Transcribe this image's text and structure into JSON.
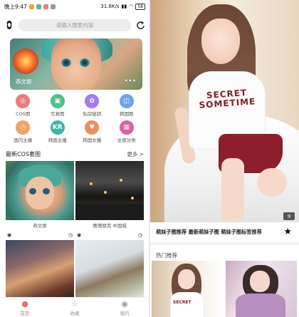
{
  "status": {
    "time": "晚上9:47",
    "speed": "31.6K/s",
    "battery": "58"
  },
  "search": {
    "placeholder": "请输入搜索内容"
  },
  "banner": {
    "title": "燕文姬",
    "dots": "•••"
  },
  "categories": [
    {
      "label": "COS图",
      "color": "#f07a7a",
      "icon": "cos-icon",
      "glyph": "◎"
    },
    {
      "label": "写真图",
      "color": "#4cc38a",
      "icon": "photo-icon",
      "glyph": "▣"
    },
    {
      "label": "私房秘钥",
      "color": "#a27cf0",
      "icon": "key-icon",
      "glyph": "✿"
    },
    {
      "label": "韩国图",
      "color": "#6aa4f3",
      "icon": "bag-icon",
      "glyph": "◫"
    },
    {
      "label": "国内主播",
      "color": "#f6a15a",
      "icon": "clock-icon",
      "glyph": "◷"
    },
    {
      "label": "韩国主播",
      "color": "#38b9a8",
      "icon": "kr-icon",
      "glyph": "KR"
    },
    {
      "label": "韩国女播",
      "color": "#f08d5c",
      "icon": "heart-icon",
      "glyph": "♥"
    },
    {
      "label": "全部分类",
      "color": "#e35da2",
      "icon": "grid-icon",
      "glyph": "▦"
    }
  ],
  "section": {
    "title": "最新COS套图",
    "more": "更多 >"
  },
  "tiles": [
    {
      "caption": "燕文姬"
    },
    {
      "caption": "赛博朋克 中国城"
    }
  ],
  "tabs": [
    {
      "label": "首页",
      "icon": "home-icon",
      "glyph": "●"
    },
    {
      "label": "收藏",
      "icon": "star-outline-icon",
      "glyph": "☆"
    },
    {
      "label": "我的",
      "icon": "user-icon",
      "glyph": "◉"
    }
  ],
  "detail": {
    "image_count": "9",
    "tags": "萌妹子图推荐  最新萌妹子图  萌妹子图标签推荐",
    "hot_title": "热门推荐"
  },
  "colors": {
    "accent": "#f36a6a",
    "shirt_text": "#8a1c28"
  },
  "shirt_text": "SECRET\nSOMETIME"
}
